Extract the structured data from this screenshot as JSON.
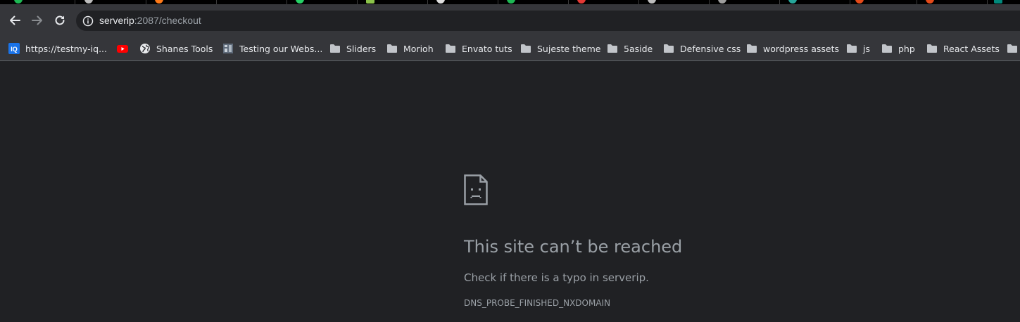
{
  "address_bar": {
    "url_host": "serverip",
    "url_rest": ":2087/checkout"
  },
  "bookmarks": [
    {
      "icon": "iq-favicon-icon",
      "label": "https://testmy-iq..."
    },
    {
      "icon": "youtube-icon",
      "label": ""
    },
    {
      "icon": "globe-icon",
      "label": "Shanes Tools"
    },
    {
      "icon": "site-favicon-icon",
      "label": "Testing our Webs..."
    },
    {
      "icon": "folder-icon",
      "label": "Sliders"
    },
    {
      "icon": "folder-icon",
      "label": "Morioh"
    },
    {
      "icon": "folder-icon",
      "label": "Envato tuts"
    },
    {
      "icon": "folder-icon",
      "label": "Sujeste theme"
    },
    {
      "icon": "folder-icon",
      "label": "5aside"
    },
    {
      "icon": "folder-icon",
      "label": "Defensive css"
    },
    {
      "icon": "folder-icon",
      "label": "wordpress assets"
    },
    {
      "icon": "folder-icon",
      "label": "js"
    },
    {
      "icon": "folder-icon",
      "label": "php"
    },
    {
      "icon": "folder-icon",
      "label": "React Assets"
    },
    {
      "icon": "folder-icon",
      "label": ""
    }
  ],
  "error": {
    "title": "This site can’t be reached",
    "message": "Check if there is a typo in serverip.",
    "code": "DNS_PROBE_FINISHED_NXDOMAIN"
  },
  "colors": {
    "page_background": "#202124",
    "toolbar": "#35363a",
    "text_primary": "#e8eaed",
    "text_secondary": "#9aa0a6",
    "youtube_red": "#ff0000",
    "iq_blue": "#1a73e8"
  }
}
